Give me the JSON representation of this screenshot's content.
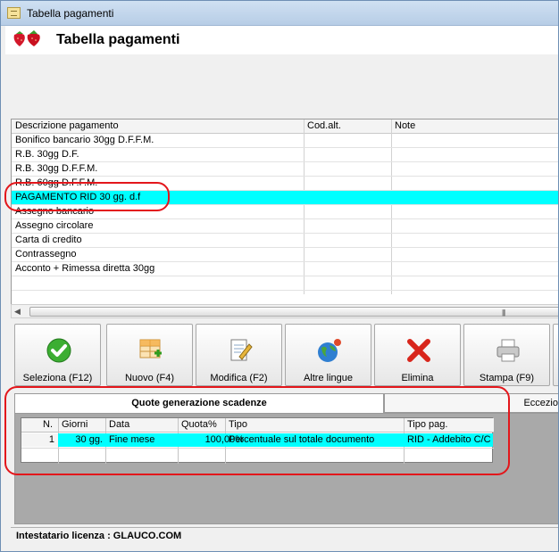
{
  "window": {
    "title": "Tabella pagamenti"
  },
  "header": {
    "title": "Tabella pagamenti",
    "logo_icon": "strawberry-icon"
  },
  "grid": {
    "columns": [
      "Descrizione pagamento",
      "Cod.alt.",
      "Note"
    ],
    "rows": [
      "Bonifico bancario 30gg D.F.F.M.",
      "R.B. 30gg D.F.",
      "R.B. 30gg D.F.F.M.",
      "R.B. 60gg D.F.F.M.",
      "PAGAMENTO RID 30 gg. d.f",
      "Assegno bancario",
      "Assegno circolare",
      "Carta di credito",
      "Contrassegno",
      "Acconto + Rimessa diretta 30gg"
    ],
    "selected_index": 4
  },
  "toolbar": {
    "select_label": "Seleziona (F12)",
    "new_label": "Nuovo (F4)",
    "edit_label": "Modifica (F2)",
    "languages_label": "Altre lingue",
    "delete_label": "Elimina",
    "print_label": "Stampa (F9)"
  },
  "tabs": {
    "active": "Quote generazione scadenze",
    "inactive": "Eccezio"
  },
  "subgrid": {
    "columns": [
      "N.",
      "Giorni",
      "Data",
      "Quota%",
      "Tipo",
      "Tipo pag."
    ],
    "row": {
      "n": "1",
      "giorni": "30 gg.",
      "data": "Fine mese",
      "quota": "100,00%",
      "tipo": "Percentuale sul totale documento",
      "tipo_pag": "RID - Addebito C/C"
    }
  },
  "status": {
    "text": "Intestatario licenza : GLAUCO.COM"
  },
  "colors": {
    "selection": "#00ffff",
    "highlight_mark": "#e3161b"
  }
}
